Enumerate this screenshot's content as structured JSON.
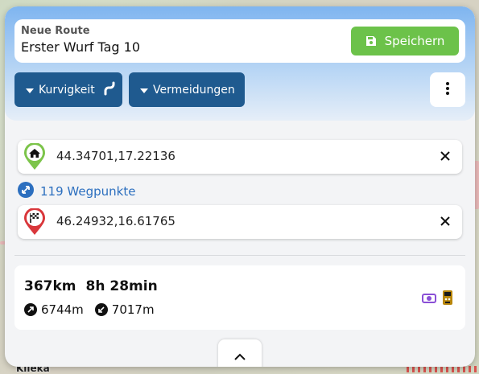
{
  "map": {
    "place_label": "Klieka"
  },
  "route": {
    "name_label": "Neue Route",
    "name_value": "Erster Wurf Tag 10",
    "save_label": "Speichern"
  },
  "options": {
    "curviness_label": "Kurvigkeit",
    "avoid_label": "Vermeidungen"
  },
  "waypoints": {
    "start": "44.34701,17.22136",
    "count_label": "119 Wegpunkte",
    "end": "46.24932,16.61765"
  },
  "summary": {
    "distance": "367km",
    "duration": "8h 28min",
    "ascent": "6744m",
    "descent": "7017m"
  },
  "colors": {
    "save": "#6cc24a",
    "primary": "#1f5a8f",
    "link": "#2c6fbf",
    "start_pin": "#7cc44a",
    "end_pin": "#d9373b",
    "toll": "#8a4fd6",
    "road_sign": "#b8860b"
  },
  "icons": [
    "save-icon",
    "caret-down-icon",
    "curve-icon",
    "more-vertical-icon",
    "home-pin-icon",
    "flag-pin-icon",
    "close-icon",
    "expand-arrows-icon",
    "ascent-arrow-icon",
    "descent-arrow-icon",
    "toll-icon",
    "road-type-icon",
    "chevron-up-icon"
  ]
}
